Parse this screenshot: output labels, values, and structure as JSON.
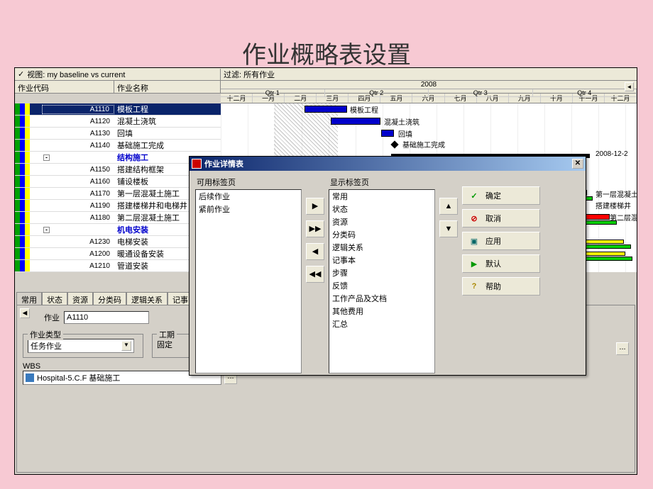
{
  "page_title": "作业概略表设置",
  "topbar": {
    "view": "视图: my baseline vs current",
    "filter": "过滤: 所有作业"
  },
  "columns": {
    "code": "作业代码",
    "name": "作业名称"
  },
  "gantt": {
    "year": "2008",
    "quarters": [
      "Qtr 1",
      "Qtr 2",
      "Qtr 3",
      "Qtr 4"
    ],
    "months": [
      "十二月",
      "一月",
      "二月",
      "三月",
      "四月",
      "五月",
      "六月",
      "七月",
      "八月",
      "九月",
      "十月",
      "十一月",
      "十二月"
    ],
    "labels": {
      "a1110": "模板工程",
      "a1120": "混凝土浇筑",
      "a1130": "回填",
      "a1140": "基础施工完成",
      "right_date": "2008-12-2",
      "r1": "第一层混凝土",
      "r2": "搭建楼梯井",
      "r3": "第二层混"
    }
  },
  "tasks": [
    {
      "code": "A1110",
      "name": "模板工程",
      "type": "sel"
    },
    {
      "code": "A1120",
      "name": "混凝土浇筑",
      "type": "norm"
    },
    {
      "code": "A1130",
      "name": "回填",
      "type": "norm"
    },
    {
      "code": "A1140",
      "name": "基础施工完成",
      "type": "norm"
    },
    {
      "code": "",
      "name": "结构施工",
      "type": "hdr"
    },
    {
      "code": "A1150",
      "name": "搭建结构框架",
      "type": "norm"
    },
    {
      "code": "A1160",
      "name": "铺设楼板",
      "type": "norm"
    },
    {
      "code": "A1170",
      "name": "第一层混凝土施工",
      "type": "norm"
    },
    {
      "code": "A1190",
      "name": "搭建楼梯井和电梯井",
      "type": "norm"
    },
    {
      "code": "A1180",
      "name": "第二层混凝土施工",
      "type": "norm"
    },
    {
      "code": "",
      "name": "机电安装",
      "type": "hdr"
    },
    {
      "code": "A1230",
      "name": "电梯安装",
      "type": "norm"
    },
    {
      "code": "A1200",
      "name": "暖通设备安装",
      "type": "norm"
    },
    {
      "code": "A1210",
      "name": "管道安装",
      "type": "norm"
    }
  ],
  "tabs": [
    "常用",
    "状态",
    "资源",
    "分类码",
    "逻辑关系",
    "记事"
  ],
  "details": {
    "activity_label": "作业",
    "activity_value": "A1110",
    "type_label": "作业类型",
    "type_value": "任务作业",
    "duration_label": "工期",
    "fixed_label": "固定",
    "wbs_label": "WBS",
    "wbs_value": "Hospital-5.C.F  基础施工"
  },
  "dialog": {
    "title": "作业详情表",
    "available_label": "可用标签页",
    "display_label": "显示标签页",
    "available_items": [
      "后续作业",
      "紧前作业"
    ],
    "display_items": [
      "常用",
      "状态",
      "资源",
      "分类码",
      "逻辑关系",
      "记事本",
      "步骤",
      "反馈",
      "工作产品及文档",
      "其他费用",
      "汇总"
    ],
    "buttons": {
      "ok": "确定",
      "cancel": "取消",
      "apply": "应用",
      "default": "默认",
      "help": "帮助"
    }
  }
}
